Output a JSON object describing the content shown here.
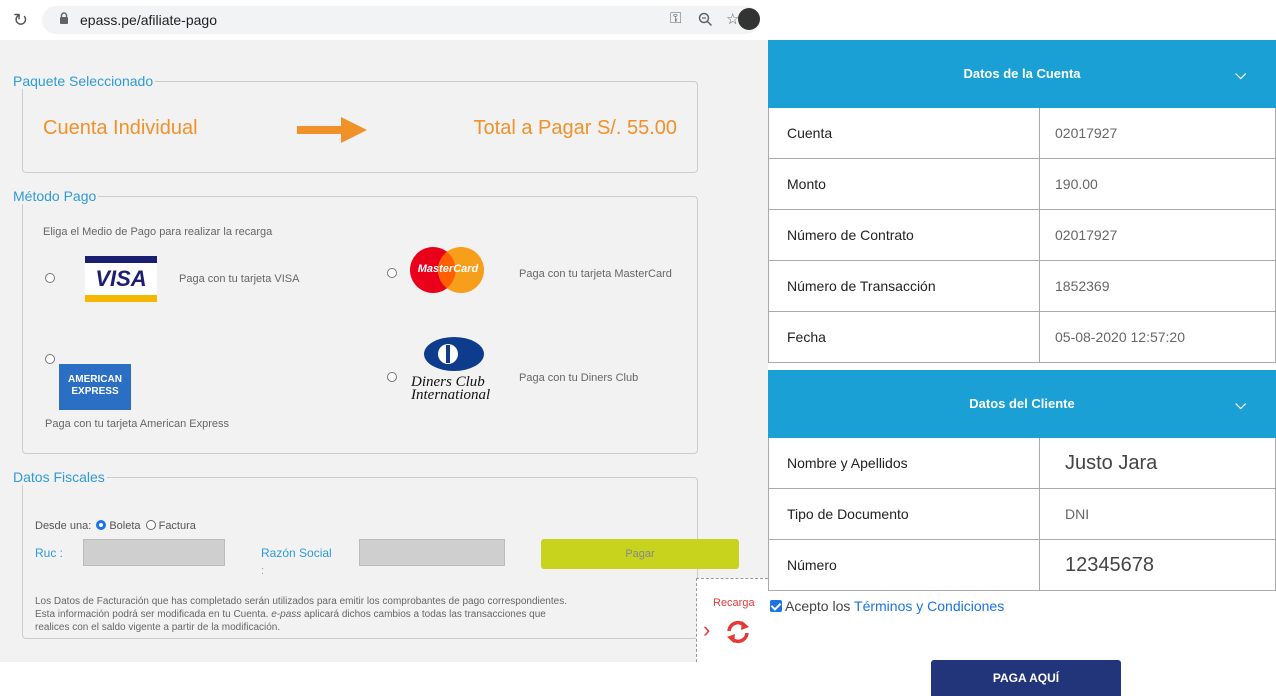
{
  "browser": {
    "url": "epass.pe/afiliate-pago"
  },
  "paquete": {
    "legend": "Paquete Seleccionado",
    "cuenta": "Cuenta Individual",
    "total": "Total a Pagar S/. 55.00",
    "accent": "#f0912a"
  },
  "metodo": {
    "legend": "Método Pago",
    "instruction": "Eliga el Medio de Pago para realizar la recarga",
    "visa_text": "Paga con tu tarjeta VISA",
    "visa_logo": "VISA",
    "mastercard_text": "Paga con tu tarjeta MasterCard",
    "mastercard_logo": "MasterCard",
    "amex_text": "Paga con tu tarjeta American Express",
    "amex_logo_1": "AMERICAN",
    "amex_logo_2": "EXPRESS",
    "diners_text": "Paga con tu Diners Club",
    "diners_logo_1": "Diners Club",
    "diners_logo_2": "International"
  },
  "fiscal": {
    "legend": "Datos Fiscales",
    "desde": "Desde una:",
    "boleta": "Boleta",
    "factura": "Factura",
    "ruc_label": "Ruc :",
    "razon_label": "Razón Social",
    "razon_colon": ":",
    "pagar": "Pagar",
    "note_1": "Los Datos de Facturación que has completado serán utilizados para emitir los comprobantes de pago correspondientes.",
    "note_2a": "Esta información podrá ser modificada en tu Cuenta. ",
    "note_2b": "e-pass",
    "note_2c": " aplicará dichos cambios a todas las transacciones que",
    "note_3": "realices con el saldo vigente a partir de la modificación."
  },
  "recarga": {
    "label": "Recarga"
  },
  "cuenta": {
    "header": "Datos de la Cuenta",
    "rows": [
      {
        "key": "Cuenta",
        "value": "02017927"
      },
      {
        "key": "Monto",
        "value": "190.00"
      },
      {
        "key": "Número de Contrato",
        "value": "02017927"
      },
      {
        "key": "Número de Transacción",
        "value": "1852369"
      },
      {
        "key": "Fecha",
        "value": "05-08-2020 12:57:20"
      }
    ]
  },
  "cliente": {
    "header": "Datos del Cliente",
    "rows": [
      {
        "key": "Nombre y Apellidos",
        "value": "Justo Jara"
      },
      {
        "key": "Tipo de Documento",
        "value": "DNI"
      },
      {
        "key": "Número",
        "value": "12345678"
      }
    ]
  },
  "terms": {
    "prefix": "Acepto los ",
    "link": "Términos y Condiciones"
  },
  "paga_button": "PAGA AQUÍ",
  "colors": {
    "header_blue": "#1ba0d6",
    "legend_blue": "#2f9bd6",
    "pagar_green": "#c7d31c",
    "paga_navy": "#23357a"
  }
}
